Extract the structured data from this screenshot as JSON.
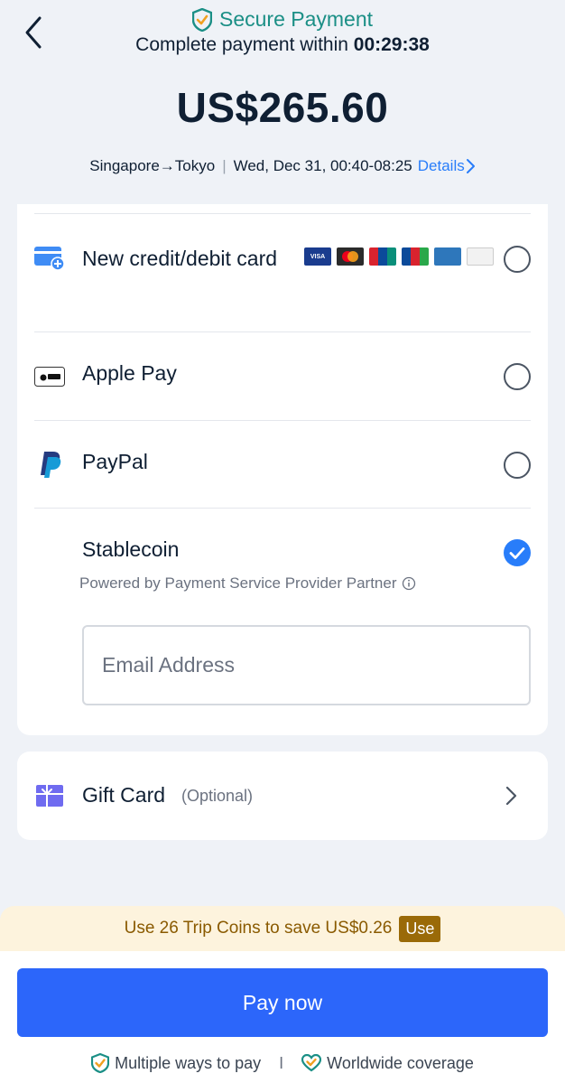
{
  "header": {
    "secure_title": "Secure Payment",
    "timer_prefix": "Complete payment within",
    "timer": "00:29:38",
    "amount": "US$265.60",
    "trip_route": "Singapore→Tokyo",
    "trip_time": "Wed, Dec 31, 00:40-08:25",
    "details_link": "Details"
  },
  "payment_methods": [
    {
      "label": "New credit/debit card",
      "icon": "credit-card-icon",
      "selected": false
    },
    {
      "label": "Apple Pay",
      "icon": "apple-pay-icon",
      "selected": false
    },
    {
      "label": "PayPal",
      "icon": "paypal-icon",
      "selected": false
    },
    {
      "label": "Stablecoin",
      "icon": "",
      "selected": true
    }
  ],
  "card_brands": [
    "VISA",
    "Mastercard",
    "UnionPay",
    "JCB",
    "AMEX",
    "DISCOVER"
  ],
  "stablecoin": {
    "note": "Powered by Payment Service Provider Partner",
    "email_placeholder": "Email Address",
    "email_value": ""
  },
  "gift_card": {
    "label": "Gift Card",
    "optional": "(Optional)"
  },
  "coins": {
    "text": "Use 26 Trip Coins to save US$0.26",
    "use_label": "Use"
  },
  "pay_button": "Pay now",
  "assurances": [
    "Multiple ways to pay",
    "Worldwide coverage"
  ],
  "assurance_separator": "I",
  "colors": {
    "accent": "#287dfa",
    "pay_button": "#2c66fa",
    "secure": "#1b8f86",
    "coins": "#9a6a08"
  }
}
